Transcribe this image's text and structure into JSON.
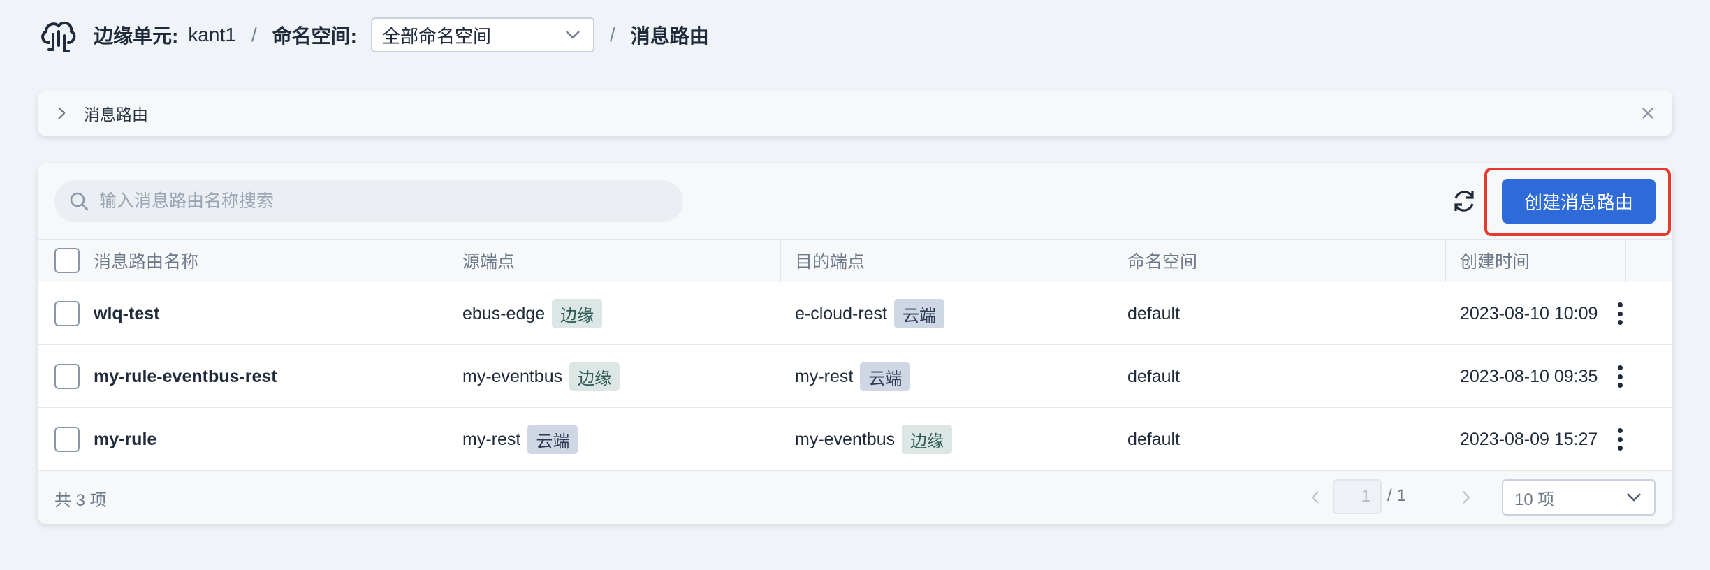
{
  "header": {
    "edge_unit_label": "边缘单元:",
    "edge_unit_value": "kant1",
    "separator": "/",
    "namespace_label": "命名空间:",
    "namespace_selected": "全部命名空间",
    "current_page": "消息路由"
  },
  "banner": {
    "title": "消息路由"
  },
  "toolbar": {
    "search_placeholder": "输入消息路由名称搜索",
    "create_button": "创建消息路由"
  },
  "table": {
    "columns": [
      "消息路由名称",
      "源端点",
      "目的端点",
      "命名空间",
      "创建时间"
    ],
    "rows": [
      {
        "name": "wlq-test",
        "source": "ebus-edge",
        "source_tag": "边缘",
        "target": "e-cloud-rest",
        "target_tag": "云端",
        "namespace": "default",
        "created": "2023-08-10 10:09"
      },
      {
        "name": "my-rule-eventbus-rest",
        "source": "my-eventbus",
        "source_tag": "边缘",
        "target": "my-rest",
        "target_tag": "云端",
        "namespace": "default",
        "created": "2023-08-10 09:35"
      },
      {
        "name": "my-rule",
        "source": "my-rest",
        "source_tag": "云端",
        "target": "my-eventbus",
        "target_tag": "边缘",
        "namespace": "default",
        "created": "2023-08-09 15:27"
      }
    ]
  },
  "footer": {
    "total": "共 3 项",
    "current_page": "1",
    "total_pages": "/ 1",
    "page_size": "10 项"
  },
  "colors": {
    "primary": "#2e6bd8",
    "highlight": "#e33b2e",
    "edge_tag_bg": "#dce7e5",
    "cloud_tag_bg": "#cfd6e4"
  },
  "icons": [
    "cloud-logo-icon",
    "chevron-down-icon",
    "chevron-right-icon",
    "close-icon",
    "search-icon",
    "refresh-icon",
    "more-vertical-icon",
    "chevron-left-icon"
  ]
}
